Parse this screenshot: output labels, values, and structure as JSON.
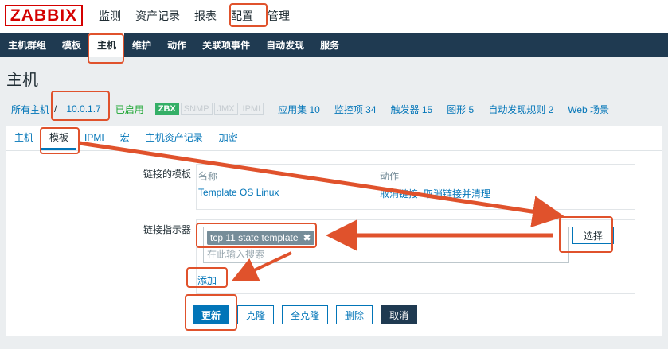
{
  "logo": "ZABBIX",
  "main_menu": [
    "监测",
    "资产记录",
    "报表",
    "配置",
    "管理"
  ],
  "sub_menu": [
    "主机群组",
    "模板",
    "主机",
    "维护",
    "动作",
    "关联项事件",
    "自动发现",
    "服务"
  ],
  "page_title": "主机",
  "host_info": {
    "all_hosts": "所有主机",
    "separator": "/",
    "host_ip": "10.0.1.7",
    "status": "已启用",
    "tags": [
      "ZBX",
      "SNMP",
      "JMX",
      "IPMI"
    ],
    "links": [
      "应用集 10",
      "监控项 34",
      "触发器 15",
      "图形 5",
      "自动发现规则 2",
      "Web 场景"
    ]
  },
  "tabs": [
    "主机",
    "模板",
    "IPMI",
    "宏",
    "主机资产记录",
    "加密"
  ],
  "linked_templates": {
    "label": "链接的模板",
    "col_name": "名称",
    "col_action": "动作",
    "template": "Template OS Linux",
    "action_unlink": "取消链接",
    "action_unlink_clear": "取消链接并清理"
  },
  "link_indicator": {
    "label": "链接指示器",
    "chip": "tcp 11 state template",
    "placeholder": "在此输入搜索",
    "select_button": "选择",
    "add_link": "添加"
  },
  "buttons": {
    "update": "更新",
    "clone": "克隆",
    "full_clone": "全克隆",
    "delete": "删除",
    "cancel": "取消"
  },
  "colors": {
    "nav_dark": "#1f3a51",
    "link_blue": "#0275b8",
    "annotation_red": "#e0522c",
    "enabled_green": "#1aa530"
  }
}
